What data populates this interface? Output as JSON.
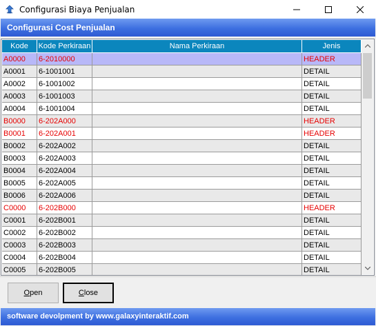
{
  "window": {
    "title": "Configurasi Biaya Penjualan"
  },
  "banner": {
    "title": "Configurasi Cost Penjualan"
  },
  "grid": {
    "columns": [
      "Kode",
      "Kode Perkiraan",
      "Nama Perkiraan",
      "Jenis"
    ],
    "rows": [
      {
        "kode": "A0000",
        "kode_perkiraan": "6-2010000",
        "nama": "",
        "jenis": "HEADER",
        "type": "header",
        "selected": true
      },
      {
        "kode": "A0001",
        "kode_perkiraan": "6-1001001",
        "nama": "",
        "jenis": "DETAIL",
        "type": "detail"
      },
      {
        "kode": "A0002",
        "kode_perkiraan": "6-1001002",
        "nama": "",
        "jenis": "DETAIL",
        "type": "detail"
      },
      {
        "kode": "A0003",
        "kode_perkiraan": "6-1001003",
        "nama": "",
        "jenis": "DETAIL",
        "type": "detail"
      },
      {
        "kode": "A0004",
        "kode_perkiraan": "6-1001004",
        "nama": "",
        "jenis": "DETAIL",
        "type": "detail"
      },
      {
        "kode": "B0000",
        "kode_perkiraan": "6-202A000",
        "nama": "",
        "jenis": "HEADER",
        "type": "header"
      },
      {
        "kode": "B0001",
        "kode_perkiraan": "6-202A001",
        "nama": "",
        "jenis": "HEADER",
        "type": "header"
      },
      {
        "kode": "B0002",
        "kode_perkiraan": "6-202A002",
        "nama": "",
        "jenis": "DETAIL",
        "type": "detail"
      },
      {
        "kode": "B0003",
        "kode_perkiraan": "6-202A003",
        "nama": "",
        "jenis": "DETAIL",
        "type": "detail"
      },
      {
        "kode": "B0004",
        "kode_perkiraan": "6-202A004",
        "nama": "",
        "jenis": "DETAIL",
        "type": "detail"
      },
      {
        "kode": "B0005",
        "kode_perkiraan": "6-202A005",
        "nama": "",
        "jenis": "DETAIL",
        "type": "detail"
      },
      {
        "kode": "B0006",
        "kode_perkiraan": "6-202A006",
        "nama": "",
        "jenis": "DETAIL",
        "type": "detail"
      },
      {
        "kode": "C0000",
        "kode_perkiraan": "6-202B000",
        "nama": "",
        "jenis": "HEADER",
        "type": "header"
      },
      {
        "kode": "C0001",
        "kode_perkiraan": "6-202B001",
        "nama": "",
        "jenis": "DETAIL",
        "type": "detail"
      },
      {
        "kode": "C0002",
        "kode_perkiraan": "6-202B002",
        "nama": "",
        "jenis": "DETAIL",
        "type": "detail"
      },
      {
        "kode": "C0003",
        "kode_perkiraan": "6-202B003",
        "nama": "",
        "jenis": "DETAIL",
        "type": "detail"
      },
      {
        "kode": "C0004",
        "kode_perkiraan": "6-202B004",
        "nama": "",
        "jenis": "DETAIL",
        "type": "detail"
      },
      {
        "kode": "C0005",
        "kode_perkiraan": "6-202B005",
        "nama": "",
        "jenis": "DETAIL",
        "type": "detail"
      }
    ]
  },
  "buttons": {
    "open_label": "Open",
    "close_label": "Close"
  },
  "status": {
    "text": "software devolpment by www.galaxyinteraktif.com"
  },
  "colors": {
    "header_row_text": "#e60000",
    "selected_row_bg": "#b8b8f8",
    "grid_header_bg": "#0b86bd",
    "banner_blue": "#3d6fe0"
  },
  "icons": {
    "app": "app-icon",
    "minimize": "minimize-icon",
    "maximize": "maximize-icon",
    "close": "close-icon",
    "scroll_up": "chevron-up-icon",
    "scroll_down": "chevron-down-icon"
  }
}
